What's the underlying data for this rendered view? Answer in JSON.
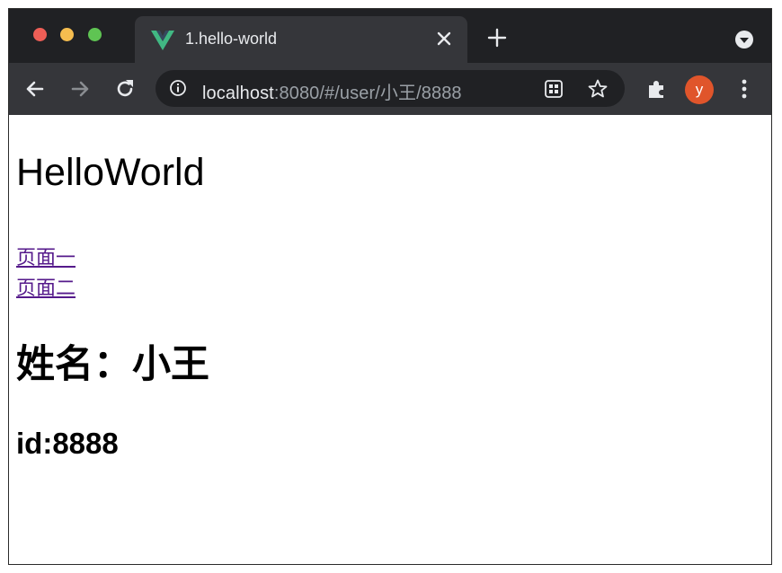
{
  "browser": {
    "tab": {
      "title": "1.hello-world",
      "favicon": "vue-logo-icon",
      "close_icon": "close-icon"
    },
    "new_tab_icon": "plus-icon",
    "tab_search_icon": "chevron-down-circle-icon",
    "toolbar": {
      "back_icon": "arrow-left-icon",
      "forward_icon": "arrow-right-icon",
      "reload_icon": "reload-icon",
      "site_info_icon": "info-icon",
      "url_host": "localhost",
      "url_path": ":8080/#/user/小王/8888",
      "apps_icon": "qr-grid-icon",
      "bookmark_icon": "star-icon",
      "extensions_icon": "puzzle-icon",
      "profile_initial": "y",
      "menu_icon": "vertical-dots-icon"
    },
    "colors": {
      "tabstrip": "#202124",
      "toolbar": "#35363a",
      "omnibox": "#202124",
      "avatar": "#e0552b",
      "link_visited": "#551a8b",
      "vue_green": "#41b883",
      "vue_dark": "#35495e"
    }
  },
  "page": {
    "heading": "HelloWorld",
    "links": [
      "页面一",
      "页面二"
    ],
    "name_line": "姓名：小王",
    "id_line": "id:8888"
  }
}
